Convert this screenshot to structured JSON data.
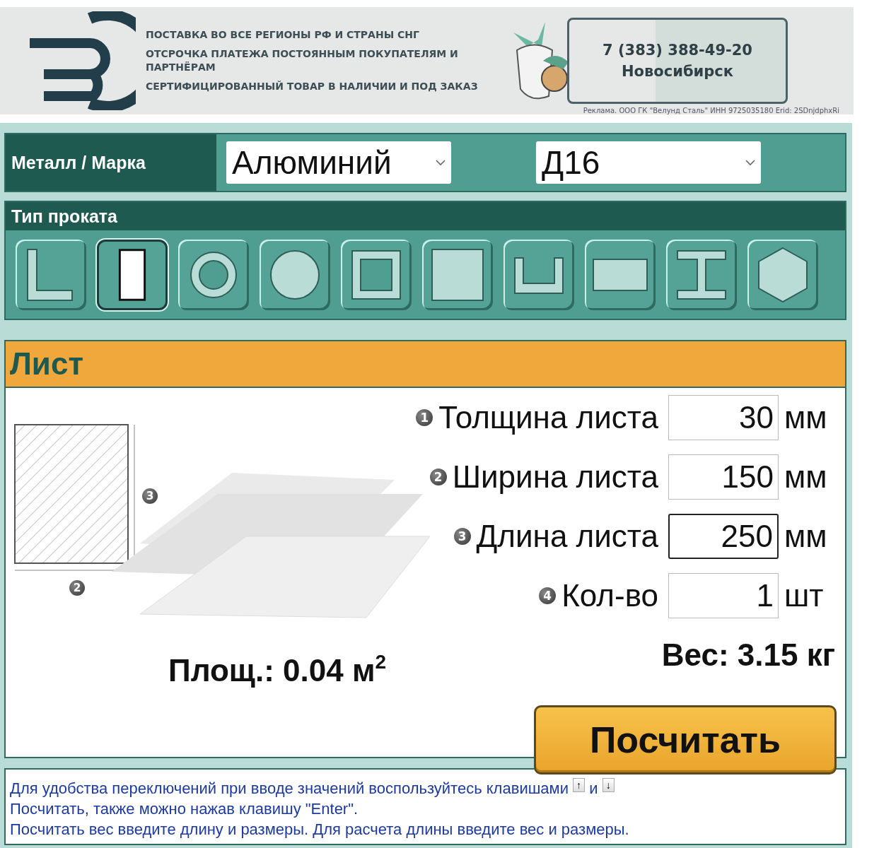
{
  "banner": {
    "slogans": [
      "ПОСТАВКА ВО ВСЕ РЕГИОНЫ РФ И СТРАНЫ СНГ",
      "ОТСРОЧКА ПЛАТЕЖА ПОСТОЯННЫМ ПОКУПАТЕЛЯМ И ПАРТНЁРАМ",
      "СЕРТИФИЦИРОВАННЫЙ ТОВАР В НАЛИЧИИ И ПОД ЗАКАЗ"
    ],
    "phone": "7 (383) 388-49-20",
    "city": "Новосибирск",
    "ad_note": "Реклама. ООО ГК \"Велунд Сталь\" ИНН 9725035180 Erid: 2SDnjdphxRi"
  },
  "metal_row": {
    "label": "Металл / Марка",
    "metal": "Алюминий",
    "grade": "Д16"
  },
  "profile_types": {
    "title": "Тип проката",
    "items": [
      {
        "kind": "angle",
        "selected": false
      },
      {
        "kind": "sheet",
        "selected": true
      },
      {
        "kind": "pipe",
        "selected": false
      },
      {
        "kind": "round",
        "selected": false
      },
      {
        "kind": "square-pipe",
        "selected": false
      },
      {
        "kind": "square",
        "selected": false
      },
      {
        "kind": "channel",
        "selected": false
      },
      {
        "kind": "strip",
        "selected": false
      },
      {
        "kind": "beam",
        "selected": false
      },
      {
        "kind": "hexagon",
        "selected": false
      }
    ]
  },
  "calculator": {
    "title": "Лист",
    "diagram_markers": [
      "3",
      "2"
    ],
    "fields": [
      {
        "number": "1",
        "label": "Толщина листа",
        "value": "30",
        "unit": "мм",
        "focused": false
      },
      {
        "number": "2",
        "label": "Ширина листа",
        "value": "150",
        "unit": "мм",
        "focused": false
      },
      {
        "number": "3",
        "label": "Длина листа",
        "value": "250",
        "unit": "мм",
        "focused": true
      },
      {
        "number": "4",
        "label": "Кол-во",
        "value": "1",
        "unit": "шт",
        "focused": false
      }
    ],
    "area": "Площ.: 0.04 м$^{2}$",
    "weight": "Вес: 3.15 кг",
    "button": "Посчитать"
  },
  "info": {
    "text_1": "Для удобства переключений при вводе значений воспользуйтесь клавишами",
    "key_up": "↑",
    "conjunction": "и",
    "key_down": "↓",
    "text_2": "Посчитать, также можно нажав клавишу \"Enter\".",
    "text_3": "Посчитать вес введите длину и размеры. Для расчета длины введите вес и размеры."
  }
}
